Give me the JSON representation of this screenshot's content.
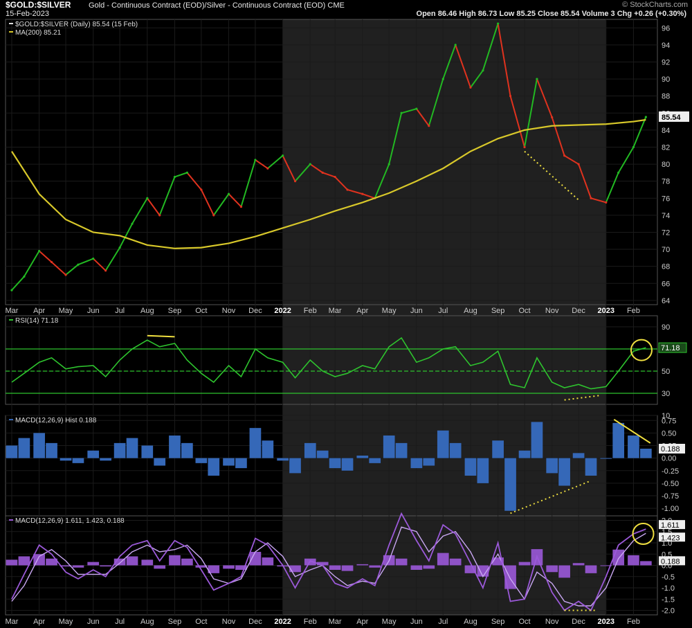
{
  "header": {
    "symbol": "$GOLD:$SILVER",
    "description": "Gold - Continuous Contract (EOD)/Silver - Continuous Contract (EOD) CME",
    "date": "15-Feb-2023",
    "brand": "© StockCharts.com",
    "ohlc": "Open 86.46   High 86.73   Low 85.25   Close 85.54   Volume 3   Chg +0.26 (+0.30%)"
  },
  "colors": {
    "up": "#22b922",
    "down": "#e0321e",
    "ma": "#d8c82a",
    "rsi": "#2ec42e",
    "hist": "#3568b8",
    "macd": "#9b59d9",
    "signal": "#c9a7f2",
    "annotation": "#f0e040",
    "highlight_band": "#202020"
  },
  "chart_data": [
    {
      "type": "line",
      "panel": "price",
      "series": [
        {
          "name": "$GOLD:$SILVER (Daily) 85.54 (15 Feb)",
          "x": [
            "2021-03-01",
            "2021-03-15",
            "2021-04-01",
            "2021-04-15",
            "2021-05-01",
            "2021-05-15",
            "2021-06-01",
            "2021-06-15",
            "2021-07-01",
            "2021-07-15",
            "2021-08-01",
            "2021-08-15",
            "2021-09-01",
            "2021-09-15",
            "2021-10-01",
            "2021-10-15",
            "2021-11-01",
            "2021-11-15",
            "2021-12-01",
            "2021-12-15",
            "2022-01-01",
            "2022-01-15",
            "2022-02-01",
            "2022-02-15",
            "2022-03-01",
            "2022-03-15",
            "2022-04-01",
            "2022-04-15",
            "2022-05-01",
            "2022-05-15",
            "2022-06-01",
            "2022-06-15",
            "2022-07-01",
            "2022-07-15",
            "2022-08-01",
            "2022-08-15",
            "2022-09-01",
            "2022-09-15",
            "2022-10-01",
            "2022-10-15",
            "2022-11-01",
            "2022-11-15",
            "2022-12-01",
            "2022-12-15",
            "2023-01-01",
            "2023-01-15",
            "2023-02-01",
            "2023-02-15"
          ],
          "values": [
            65.2,
            66.8,
            69.8,
            68.5,
            67.0,
            68.2,
            68.9,
            67.5,
            70.2,
            73.0,
            76.0,
            74.0,
            78.5,
            79.0,
            77.0,
            74.0,
            76.5,
            75.0,
            80.5,
            79.5,
            81.0,
            78.0,
            80.0,
            79.0,
            78.5,
            77.0,
            76.5,
            76.0,
            80.0,
            86.0,
            86.5,
            84.5,
            90.0,
            94.0,
            89.0,
            91.0,
            96.5,
            88.0,
            82.0,
            90.0,
            85.5,
            81.0,
            80.0,
            76.0,
            75.5,
            79.0,
            82.0,
            85.54
          ]
        },
        {
          "name": "MA(200) 85.21",
          "x": [
            "2021-03-01",
            "2021-04-01",
            "2021-05-01",
            "2021-06-01",
            "2021-07-01",
            "2021-08-01",
            "2021-09-01",
            "2021-10-01",
            "2021-11-01",
            "2021-12-01",
            "2022-01-01",
            "2022-02-01",
            "2022-03-01",
            "2022-04-01",
            "2022-05-01",
            "2022-06-01",
            "2022-07-01",
            "2022-08-01",
            "2022-09-01",
            "2022-10-01",
            "2022-11-01",
            "2022-12-01",
            "2023-01-01",
            "2023-02-01",
            "2023-02-15"
          ],
          "values": [
            81.5,
            76.5,
            73.5,
            72.0,
            71.6,
            70.5,
            70.1,
            70.2,
            70.7,
            71.5,
            72.5,
            73.5,
            74.5,
            75.5,
            76.6,
            78.0,
            79.5,
            81.5,
            83.0,
            84.0,
            84.5,
            84.6,
            84.7,
            85.0,
            85.21
          ]
        }
      ],
      "ylim": [
        63.5,
        97
      ],
      "yticks": [
        "96",
        "94",
        "92",
        "90",
        "88",
        "86",
        "84",
        "82",
        "80",
        "78",
        "76",
        "74",
        "72",
        "70",
        "68",
        "66",
        "64"
      ],
      "last_value_label": "85.54"
    },
    {
      "type": "line",
      "panel": "rsi",
      "series": [
        {
          "name": "RSI(14) 71.18",
          "x": [
            "2021-03-01",
            "2021-03-15",
            "2021-04-01",
            "2021-04-15",
            "2021-05-01",
            "2021-05-15",
            "2021-06-01",
            "2021-06-15",
            "2021-07-01",
            "2021-07-15",
            "2021-08-01",
            "2021-08-15",
            "2021-09-01",
            "2021-09-15",
            "2021-10-01",
            "2021-10-15",
            "2021-11-01",
            "2021-11-15",
            "2021-12-01",
            "2021-12-15",
            "2022-01-01",
            "2022-01-15",
            "2022-02-01",
            "2022-02-15",
            "2022-03-01",
            "2022-03-15",
            "2022-04-01",
            "2022-04-15",
            "2022-05-01",
            "2022-05-15",
            "2022-06-01",
            "2022-06-15",
            "2022-07-01",
            "2022-07-15",
            "2022-08-01",
            "2022-08-15",
            "2022-09-01",
            "2022-09-15",
            "2022-10-01",
            "2022-10-15",
            "2022-11-01",
            "2022-11-15",
            "2022-12-01",
            "2022-12-15",
            "2023-01-01",
            "2023-01-15",
            "2023-02-01",
            "2023-02-15"
          ],
          "values": [
            40,
            48,
            58,
            62,
            52,
            54,
            55,
            45,
            60,
            70,
            78,
            72,
            75,
            60,
            48,
            40,
            55,
            45,
            70,
            62,
            58,
            44,
            60,
            50,
            45,
            48,
            55,
            52,
            72,
            80,
            58,
            62,
            70,
            72,
            55,
            58,
            68,
            38,
            35,
            62,
            40,
            35,
            38,
            34,
            36,
            50,
            68,
            71.18
          ]
        }
      ],
      "ylim": [
        20,
        100
      ],
      "yticks": [
        "90",
        "70",
        "50",
        "30",
        "10"
      ],
      "reference_lines": [
        70,
        50,
        30
      ],
      "last_value_label": "71.18"
    },
    {
      "type": "bar",
      "panel": "macd_histogram",
      "series": [
        {
          "name": "MACD(12,26,9) Hist 0.188",
          "x": [
            "2021-03-01",
            "2021-03-15",
            "2021-04-01",
            "2021-04-15",
            "2021-05-01",
            "2021-05-15",
            "2021-06-01",
            "2021-06-15",
            "2021-07-01",
            "2021-07-15",
            "2021-08-01",
            "2021-08-15",
            "2021-09-01",
            "2021-09-15",
            "2021-10-01",
            "2021-10-15",
            "2021-11-01",
            "2021-11-15",
            "2021-12-01",
            "2021-12-15",
            "2022-01-01",
            "2022-01-15",
            "2022-02-01",
            "2022-02-15",
            "2022-03-01",
            "2022-03-15",
            "2022-04-01",
            "2022-04-15",
            "2022-05-01",
            "2022-05-15",
            "2022-06-01",
            "2022-06-15",
            "2022-07-01",
            "2022-07-15",
            "2022-08-01",
            "2022-08-15",
            "2022-09-01",
            "2022-09-15",
            "2022-10-01",
            "2022-10-15",
            "2022-11-01",
            "2022-11-15",
            "2022-12-01",
            "2022-12-15",
            "2023-01-01",
            "2023-01-15",
            "2023-02-01",
            "2023-02-15"
          ],
          "values": [
            0.25,
            0.4,
            0.5,
            0.3,
            -0.05,
            -0.1,
            0.15,
            -0.05,
            0.3,
            0.4,
            0.25,
            -0.15,
            0.45,
            0.3,
            -0.1,
            -0.35,
            -0.15,
            -0.2,
            0.6,
            0.35,
            -0.05,
            -0.3,
            0.3,
            0.15,
            -0.2,
            -0.25,
            0.05,
            -0.1,
            0.45,
            0.3,
            -0.2,
            -0.15,
            0.55,
            0.3,
            -0.35,
            -0.5,
            0.35,
            -1.05,
            0.15,
            0.72,
            -0.3,
            -0.55,
            0.1,
            -0.35,
            0.0,
            0.7,
            0.45,
            0.188
          ]
        }
      ],
      "ylim": [
        -1.15,
        0.85
      ],
      "yticks": [
        "0.75",
        "0.50",
        "0.25",
        "0.00",
        "-0.25",
        "-0.50",
        "-0.75",
        "-1.00"
      ],
      "last_value_label": "0.188"
    },
    {
      "type": "line",
      "panel": "macd",
      "series": [
        {
          "name": "MACD(12,26,9) 1.611, 1.423, 0.188",
          "x": [
            "2021-03-01",
            "2021-03-15",
            "2021-04-01",
            "2021-04-15",
            "2021-05-01",
            "2021-05-15",
            "2021-06-01",
            "2021-06-15",
            "2021-07-01",
            "2021-07-15",
            "2021-08-01",
            "2021-08-15",
            "2021-09-01",
            "2021-09-15",
            "2021-10-01",
            "2021-10-15",
            "2021-11-01",
            "2021-11-15",
            "2021-12-01",
            "2021-12-15",
            "2022-01-01",
            "2022-01-15",
            "2022-02-01",
            "2022-02-15",
            "2022-03-01",
            "2022-03-15",
            "2022-04-01",
            "2022-04-15",
            "2022-05-01",
            "2022-05-15",
            "2022-06-01",
            "2022-06-15",
            "2022-07-01",
            "2022-07-15",
            "2022-08-01",
            "2022-08-15",
            "2022-09-01",
            "2022-09-15",
            "2022-10-01",
            "2022-10-15",
            "2022-11-01",
            "2022-11-15",
            "2022-12-01",
            "2022-12-15",
            "2023-01-01",
            "2023-01-15",
            "2023-02-01",
            "2023-02-15"
          ],
          "values": [
            -1.5,
            -0.4,
            0.9,
            0.5,
            -0.3,
            -0.6,
            -0.2,
            -0.5,
            0.4,
            0.9,
            1.1,
            0.2,
            1.1,
            0.8,
            -0.2,
            -1.1,
            -0.8,
            -0.5,
            1.2,
            0.9,
            0.0,
            -1.0,
            0.2,
            0.0,
            -0.8,
            -1.0,
            -0.6,
            -0.9,
            0.9,
            2.3,
            1.1,
            0.2,
            1.8,
            1.4,
            0.1,
            -1.0,
            1.0,
            -1.6,
            -1.5,
            0.4,
            -1.2,
            -2.0,
            -1.6,
            -2.0,
            -0.5,
            0.9,
            1.4,
            1.611
          ]
        },
        {
          "name": "signal",
          "x": [
            "2021-03-01",
            "2021-03-15",
            "2021-04-01",
            "2021-04-15",
            "2021-05-01",
            "2021-05-15",
            "2021-06-01",
            "2021-06-15",
            "2021-07-01",
            "2021-07-15",
            "2021-08-01",
            "2021-08-15",
            "2021-09-01",
            "2021-09-15",
            "2021-10-01",
            "2021-10-15",
            "2021-11-01",
            "2021-11-15",
            "2021-12-01",
            "2021-12-15",
            "2022-01-01",
            "2022-01-15",
            "2022-02-01",
            "2022-02-15",
            "2022-03-01",
            "2022-03-15",
            "2022-04-01",
            "2022-04-15",
            "2022-05-01",
            "2022-05-15",
            "2022-06-01",
            "2022-06-15",
            "2022-07-01",
            "2022-07-15",
            "2022-08-01",
            "2022-08-15",
            "2022-09-01",
            "2022-09-15",
            "2022-10-01",
            "2022-10-15",
            "2022-11-01",
            "2022-11-15",
            "2022-12-01",
            "2022-12-15",
            "2023-01-01",
            "2023-01-15",
            "2023-02-01",
            "2023-02-15"
          ],
          "values": [
            -1.6,
            -0.9,
            0.4,
            0.7,
            0.2,
            -0.4,
            -0.4,
            -0.4,
            0.1,
            0.6,
            0.9,
            0.6,
            0.7,
            0.9,
            0.3,
            -0.6,
            -0.8,
            -0.6,
            0.6,
            1.0,
            0.4,
            -0.5,
            -0.2,
            0.0,
            -0.5,
            -0.9,
            -0.7,
            -0.8,
            0.2,
            1.7,
            1.5,
            0.6,
            1.3,
            1.5,
            0.6,
            -0.5,
            0.5,
            -0.6,
            -1.5,
            -0.3,
            -0.8,
            -1.6,
            -1.8,
            -1.8,
            -1.0,
            0.3,
            1.1,
            1.423
          ]
        }
      ],
      "ylim": [
        -2.2,
        2.2
      ],
      "yticks": [
        "2.0",
        "1.5",
        "1.0",
        "0.5",
        "0.0",
        "-0.5",
        "-1.0",
        "-1.5",
        "-2.0"
      ],
      "last_value_labels": [
        "1.611",
        "1.423",
        "0.188"
      ]
    }
  ],
  "x_axis": {
    "start": "2021-02-22",
    "end": "2023-02-28",
    "labels": [
      {
        "date": "2021-03-01",
        "text": "Mar"
      },
      {
        "date": "2021-04-01",
        "text": "Apr"
      },
      {
        "date": "2021-05-01",
        "text": "May"
      },
      {
        "date": "2021-06-01",
        "text": "Jun"
      },
      {
        "date": "2021-07-01",
        "text": "Jul"
      },
      {
        "date": "2021-08-01",
        "text": "Aug"
      },
      {
        "date": "2021-09-01",
        "text": "Sep"
      },
      {
        "date": "2021-10-01",
        "text": "Oct"
      },
      {
        "date": "2021-11-01",
        "text": "Nov"
      },
      {
        "date": "2021-12-01",
        "text": "Dec"
      },
      {
        "date": "2022-01-01",
        "text": "2022",
        "bold": true
      },
      {
        "date": "2022-02-01",
        "text": "Feb"
      },
      {
        "date": "2022-03-01",
        "text": "Mar"
      },
      {
        "date": "2022-04-01",
        "text": "Apr"
      },
      {
        "date": "2022-05-01",
        "text": "May"
      },
      {
        "date": "2022-06-01",
        "text": "Jun"
      },
      {
        "date": "2022-07-01",
        "text": "Jul"
      },
      {
        "date": "2022-08-01",
        "text": "Aug"
      },
      {
        "date": "2022-09-01",
        "text": "Sep"
      },
      {
        "date": "2022-10-01",
        "text": "Oct"
      },
      {
        "date": "2022-11-01",
        "text": "Nov"
      },
      {
        "date": "2022-12-01",
        "text": "Dec"
      },
      {
        "date": "2023-01-01",
        "text": "2023",
        "bold": true
      },
      {
        "date": "2023-02-01",
        "text": "Feb"
      }
    ],
    "shaded_period": [
      "2022-01-01",
      "2023-01-01"
    ]
  },
  "annotations": [
    {
      "panel": "price",
      "kind": "dotted-line",
      "from": [
        "2022-10-01",
        81.5
      ],
      "to": [
        "2022-12-01",
        75.8
      ]
    },
    {
      "panel": "rsi",
      "kind": "solid-line",
      "from": [
        "2021-08-01",
        82
      ],
      "to": [
        "2021-09-01",
        81
      ]
    },
    {
      "panel": "rsi",
      "kind": "dotted-line",
      "from": [
        "2022-11-15",
        24
      ],
      "to": [
        "2022-12-25",
        28
      ]
    },
    {
      "panel": "rsi",
      "kind": "circle",
      "center": [
        "2023-02-10",
        69
      ]
    },
    {
      "panel": "macd_histogram",
      "kind": "dotted-line",
      "from": [
        "2022-09-15",
        -1.1
      ],
      "to": [
        "2022-12-15",
        -0.45
      ]
    },
    {
      "panel": "macd_histogram",
      "kind": "solid-line",
      "from": [
        "2023-01-10",
        0.77
      ],
      "to": [
        "2023-02-20",
        0.3
      ]
    },
    {
      "panel": "macd",
      "kind": "dotted-line",
      "from": [
        "2022-11-15",
        -2.0
      ],
      "to": [
        "2022-12-20",
        -2.0
      ]
    },
    {
      "panel": "macd",
      "kind": "circle",
      "center": [
        "2023-02-12",
        1.4
      ]
    }
  ]
}
